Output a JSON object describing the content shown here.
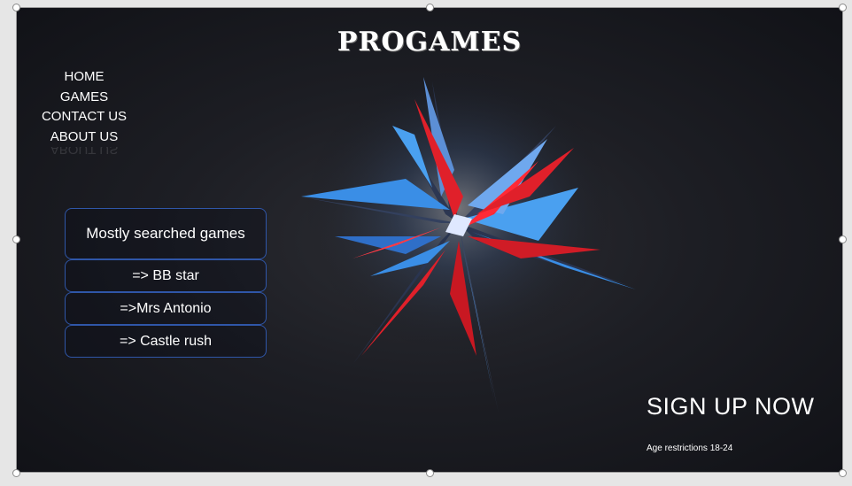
{
  "slide": {
    "title": "PROGAMES",
    "nav": {
      "items": [
        {
          "label": "HOME"
        },
        {
          "label": "GAMES"
        },
        {
          "label": "CONTACT US"
        },
        {
          "label": "ABOUT US"
        }
      ]
    },
    "games": {
      "header": "Mostly searched games",
      "items": [
        {
          "label": "=> BB star"
        },
        {
          "label": "=>Mrs Antonio"
        },
        {
          "label": "=> Castle rush"
        }
      ]
    },
    "signup_label": "SIGN UP NOW",
    "age_note": "Age restrictions 18-24"
  },
  "colors": {
    "background": "#1d1e24",
    "box_border": "#2f56a8",
    "art_blue": "#3a8ee6",
    "art_red": "#e0202a"
  },
  "icons": {
    "rotate": "rotate-icon",
    "art": "abstract-star-art"
  }
}
